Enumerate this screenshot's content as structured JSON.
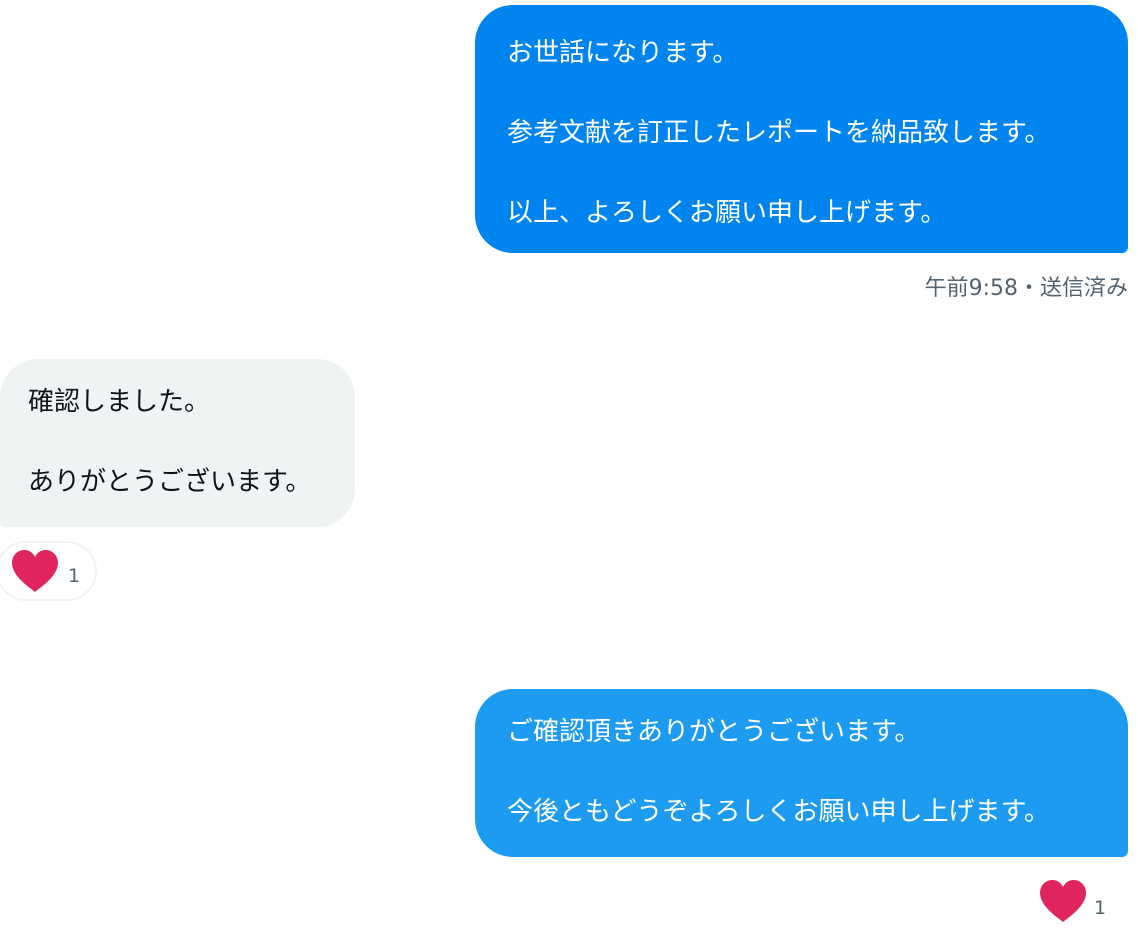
{
  "messages": [
    {
      "direction": "outgoing",
      "lines": [
        "お世話になります。",
        "参考文献を訂正したレポートを納品致します。",
        "以上、よろしくお願い申し上げます。"
      ],
      "meta": "午前9:58・送信済み"
    },
    {
      "direction": "incoming",
      "lines": [
        "確認しました。",
        "ありがとうございます。"
      ],
      "reaction": {
        "icon": "heart-icon",
        "count": "1"
      }
    },
    {
      "direction": "outgoing",
      "lines": [
        "ご確認頂きありがとうございます。",
        "今後ともどうぞよろしくお願い申し上げます。"
      ],
      "reaction": {
        "icon": "heart-icon",
        "count": "1"
      }
    }
  ],
  "colors": {
    "outgoing_bubble": "#0084f0",
    "outgoing_bubble_latest": "#1d9bf0",
    "incoming_bubble": "#eff3f4",
    "heart": "#e0245e",
    "meta_text": "#536471"
  }
}
